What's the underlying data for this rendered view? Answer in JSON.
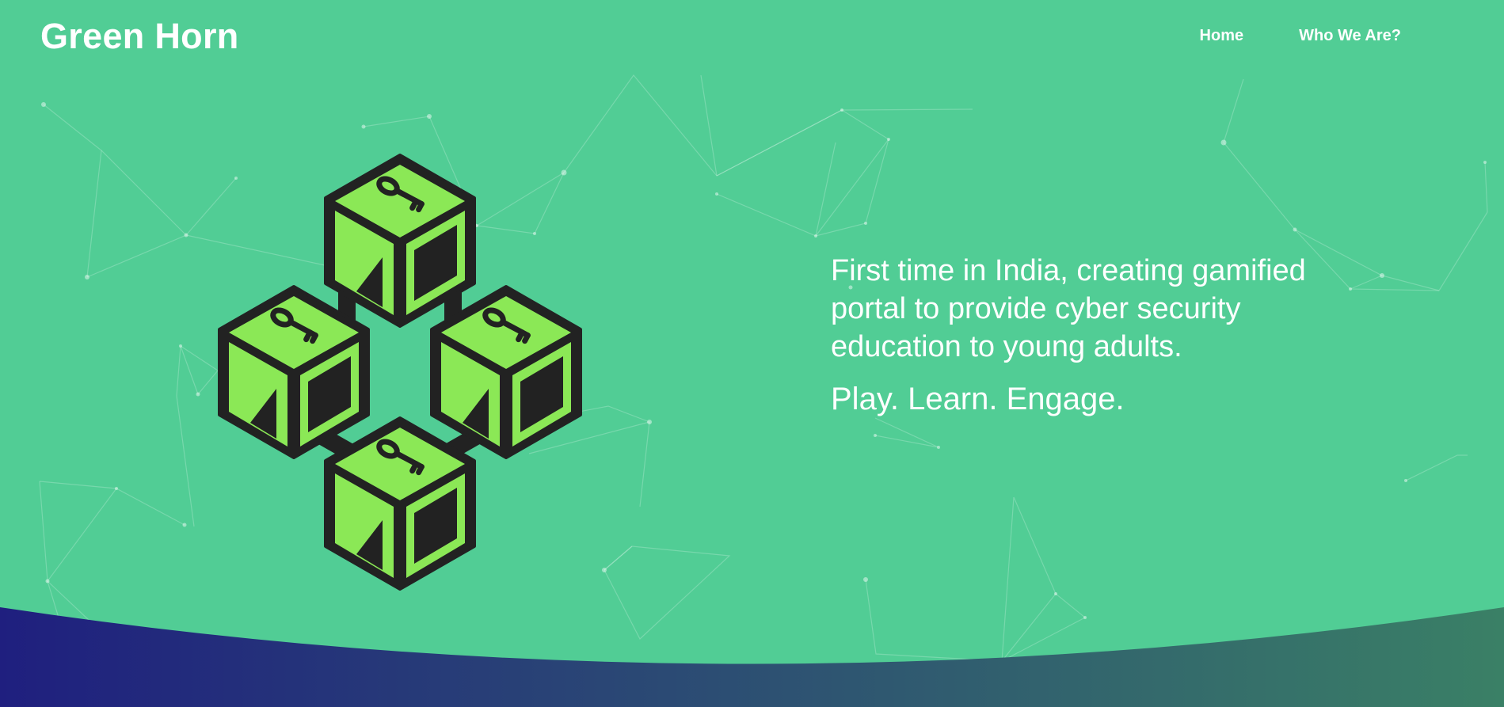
{
  "brand": {
    "name": "Green Horn"
  },
  "nav": {
    "items": [
      {
        "label": "Home"
      },
      {
        "label": "Who We Are?"
      }
    ]
  },
  "hero": {
    "tagline": "First time in India, creating gamified portal to provide cyber security education to young adults.",
    "motto": "Play. Learn. Engage.",
    "graphic": {
      "icon": "blockchain-cubes-key-icon",
      "cube_count": 4
    }
  },
  "colors": {
    "background": "#51cd95",
    "cube_face_light": "#8be856",
    "cube_face_dark": "#222222",
    "cube_outline": "#222222",
    "wave_gradient_start": "#1f1f7f",
    "wave_gradient_end": "#3a8066",
    "text": "#ffffff"
  }
}
